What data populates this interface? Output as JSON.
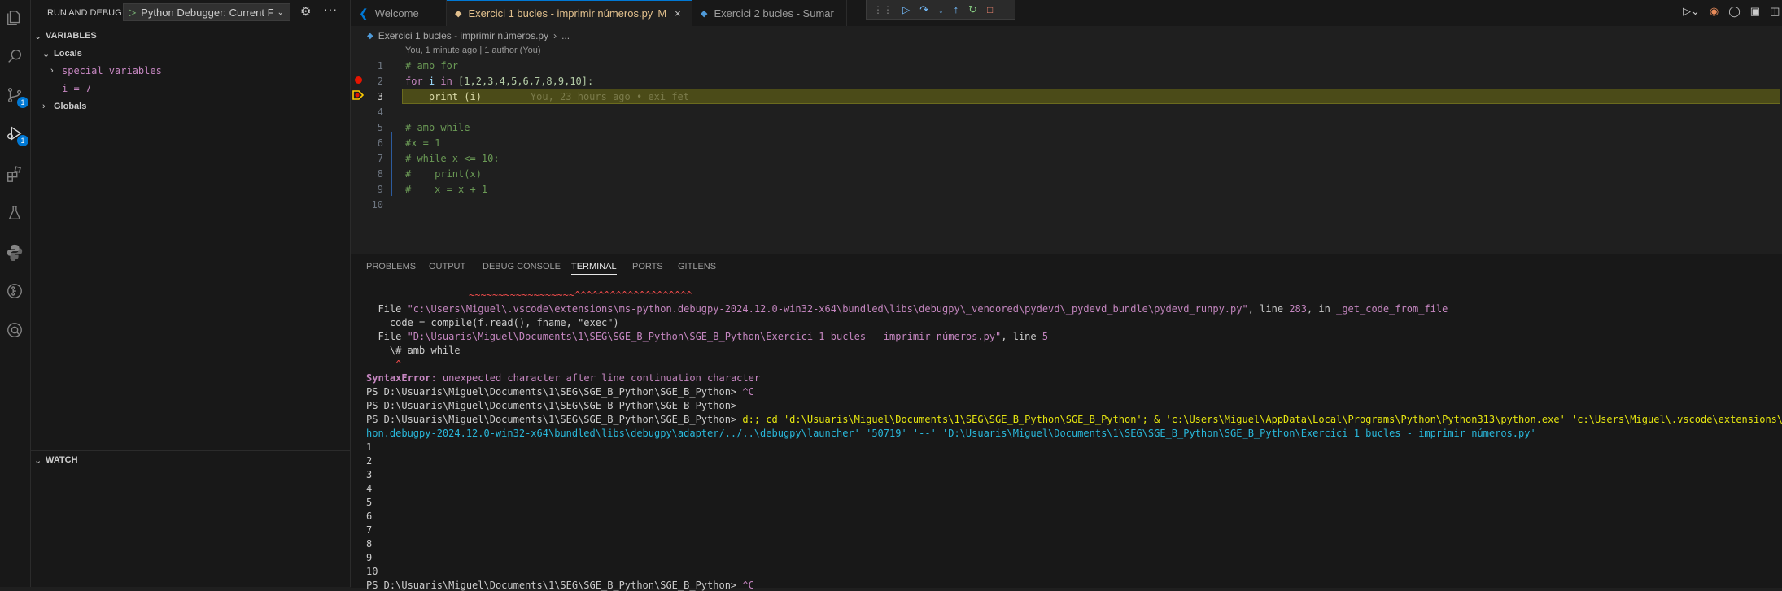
{
  "sidebar": {
    "title": "RUN AND DEBUG",
    "config": "Python Debugger: Current F",
    "variables_header": "VARIABLES",
    "locals_label": "Locals",
    "special_vars": "special variables",
    "var_i": "i = 7",
    "globals_label": "Globals",
    "watch_header": "WATCH"
  },
  "activity": {
    "badges": {
      "source_control": "1",
      "run_debug": "1"
    }
  },
  "tabs": [
    {
      "label": "Welcome",
      "icon": "vscode-icon"
    },
    {
      "label": "Exercici 1 bucles - imprimir números.py",
      "modified": "M",
      "close": "×"
    },
    {
      "label": "Exercici 2 bucles - Sumar",
      "icon": "python-icon"
    }
  ],
  "editor": {
    "breadcrumb_file": "Exercici 1 bucles - imprimir números.py",
    "breadcrumb_more": "...",
    "blame": "You, 1 minute ago | 1 author (You)",
    "line_numbers": [
      "1",
      "2",
      "3",
      "4",
      "5",
      "6",
      "7",
      "8",
      "9",
      "10"
    ],
    "lines": {
      "l1": "# amb for",
      "l2_kw": "for",
      "l2_var": " i ",
      "l2_in": "in",
      "l2_list": " [1,2,3,4,5,6,7,8,9,10]:",
      "l3": "    print (i)",
      "l3_blame": "You, 23 hours ago • exi fet",
      "l5": "# amb while",
      "l6": "#x = 1",
      "l7": "# while x <= 10:",
      "l8": "#    print(x)",
      "l9": "#    x = x + 1"
    }
  },
  "panel": {
    "tabs": [
      "PROBLEMS",
      "OUTPUT",
      "DEBUG CONSOLE",
      "TERMINAL",
      "PORTS",
      "GITLENS"
    ],
    "active_tab": "TERMINAL",
    "terminal": {
      "carets": "~~~~~~~~~~~~~~~~~~^^^^^^^^^^^^^^^^^^^^",
      "file1_pre": "  File ",
      "file1_path": "\"c:\\Users\\Miguel\\.vscode\\extensions\\ms-python.debugpy-2024.12.0-win32-x64\\bundled\\libs\\debugpy\\_vendored\\pydevd\\_pydevd_bundle\\pydevd_runpy.py\"",
      "file1_mid": ", line ",
      "file1_line": "283",
      "file1_in": ", in ",
      "file1_fn": "_get_code_from_file",
      "code_line": "    code = compile(f.read(), fname, \"exec\")",
      "file2_pre": "  File ",
      "file2_path": "\"D:\\Usuaris\\Miguel\\Documents\\1\\SEG\\SGE_B_Python\\SGE_B_Python\\Exercici 1 bucles - imprimir números.py\"",
      "file2_mid": ", line ",
      "file2_line": "5",
      "src_line": "    \\# amb while",
      "caret2": "     ^",
      "err_name": "SyntaxError",
      "err_msg": ": unexpected character after line continuation character",
      "prompt": "PS D:\\Usuaris\\Miguel\\Documents\\1\\SEG\\SGE_B_Python\\SGE_B_Python> ",
      "ctrl_c": "^C",
      "cmd1": "d:; cd 'd:\\Usuaris\\Miguel\\Documents\\1\\SEG\\SGE_B_Python\\SGE_B_Python'; & 'c:\\Users\\Miguel\\AppData\\Local\\Programs\\Python\\Python313\\python.exe' 'c:\\Users\\Miguel\\.vscode\\extensions\\ms-pyt",
      "cmd2": "hon.debugpy-2024.12.0-win32-x64\\bundled\\libs\\debugpy\\adapter/../..\\debugpy\\launcher' '50719' '--' 'D:\\Usuaris\\Miguel\\Documents\\1\\SEG\\SGE_B_Python\\SGE_B_Python\\Exercici 1 bucles - imprimir números.py'",
      "outputs": [
        "1",
        "2",
        "3",
        "4",
        "5",
        "6",
        "7",
        "8",
        "9",
        "10"
      ]
    }
  },
  "colors": {
    "accent": "#0078d4",
    "breakpoint": "#e51400",
    "current_line": "#4b4b18"
  }
}
